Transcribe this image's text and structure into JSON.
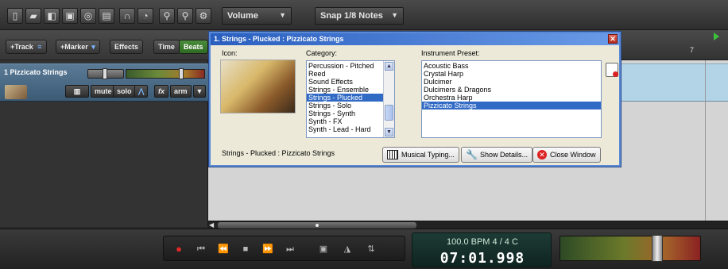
{
  "toolbar": {
    "icons": [
      "new-file-icon",
      "open-folder-icon",
      "open-project-icon",
      "save-icon",
      "record-settings-icon",
      "export-icon",
      "loop-icon",
      "metronome-icon",
      "add-user-icon",
      "search-user-icon",
      "settings-gear-icon"
    ],
    "volume_select": "Volume",
    "snap_select": "Snap 1/8 Notes"
  },
  "left_panel": {
    "add_track": "+Track",
    "add_marker": "+Marker",
    "effects": "Effects",
    "time": "Time",
    "beats": "Beats"
  },
  "track": {
    "name": "1 Pizzicato Strings",
    "mute": "mute",
    "solo": "solo",
    "fx": "fx",
    "arm": "arm"
  },
  "ruler": {
    "marker": "7"
  },
  "dialog": {
    "title": "1. Strings - Plucked : Pizzicato Strings",
    "icon_label": "Icon:",
    "category_label": "Category:",
    "preset_label": "Instrument Preset:",
    "categories": [
      {
        "label": "Percussion - Pitched",
        "selected": false
      },
      {
        "label": "Reed",
        "selected": false
      },
      {
        "label": "Sound Effects",
        "selected": false
      },
      {
        "label": "Strings - Ensemble",
        "selected": false
      },
      {
        "label": "Strings - Plucked",
        "selected": true
      },
      {
        "label": "Strings - Solo",
        "selected": false
      },
      {
        "label": "Strings - Synth",
        "selected": false
      },
      {
        "label": "Synth - FX",
        "selected": false
      },
      {
        "label": "Synth - Lead - Hard",
        "selected": false
      }
    ],
    "presets": [
      {
        "label": "Acoustic Bass",
        "selected": false
      },
      {
        "label": "Crystal Harp",
        "selected": false
      },
      {
        "label": "Dulcimer",
        "selected": false
      },
      {
        "label": "Dulcimers & Dragons",
        "selected": false
      },
      {
        "label": "Orchestra Harp",
        "selected": false
      },
      {
        "label": "Pizzicato Strings",
        "selected": true
      }
    ],
    "status": "Strings - Plucked : Pizzicato Strings",
    "musical_typing": "Musical Typing...",
    "show_details": "Show Details...",
    "close_window": "Close Window"
  },
  "transport": {
    "tempo_line": "100.0 BPM   4 / 4   C",
    "time": "07:01.998"
  },
  "colors": {
    "accent": "#316ac5",
    "record": "#e02a2a",
    "track": "#5a7a96",
    "lcd": "#1d3b35"
  }
}
